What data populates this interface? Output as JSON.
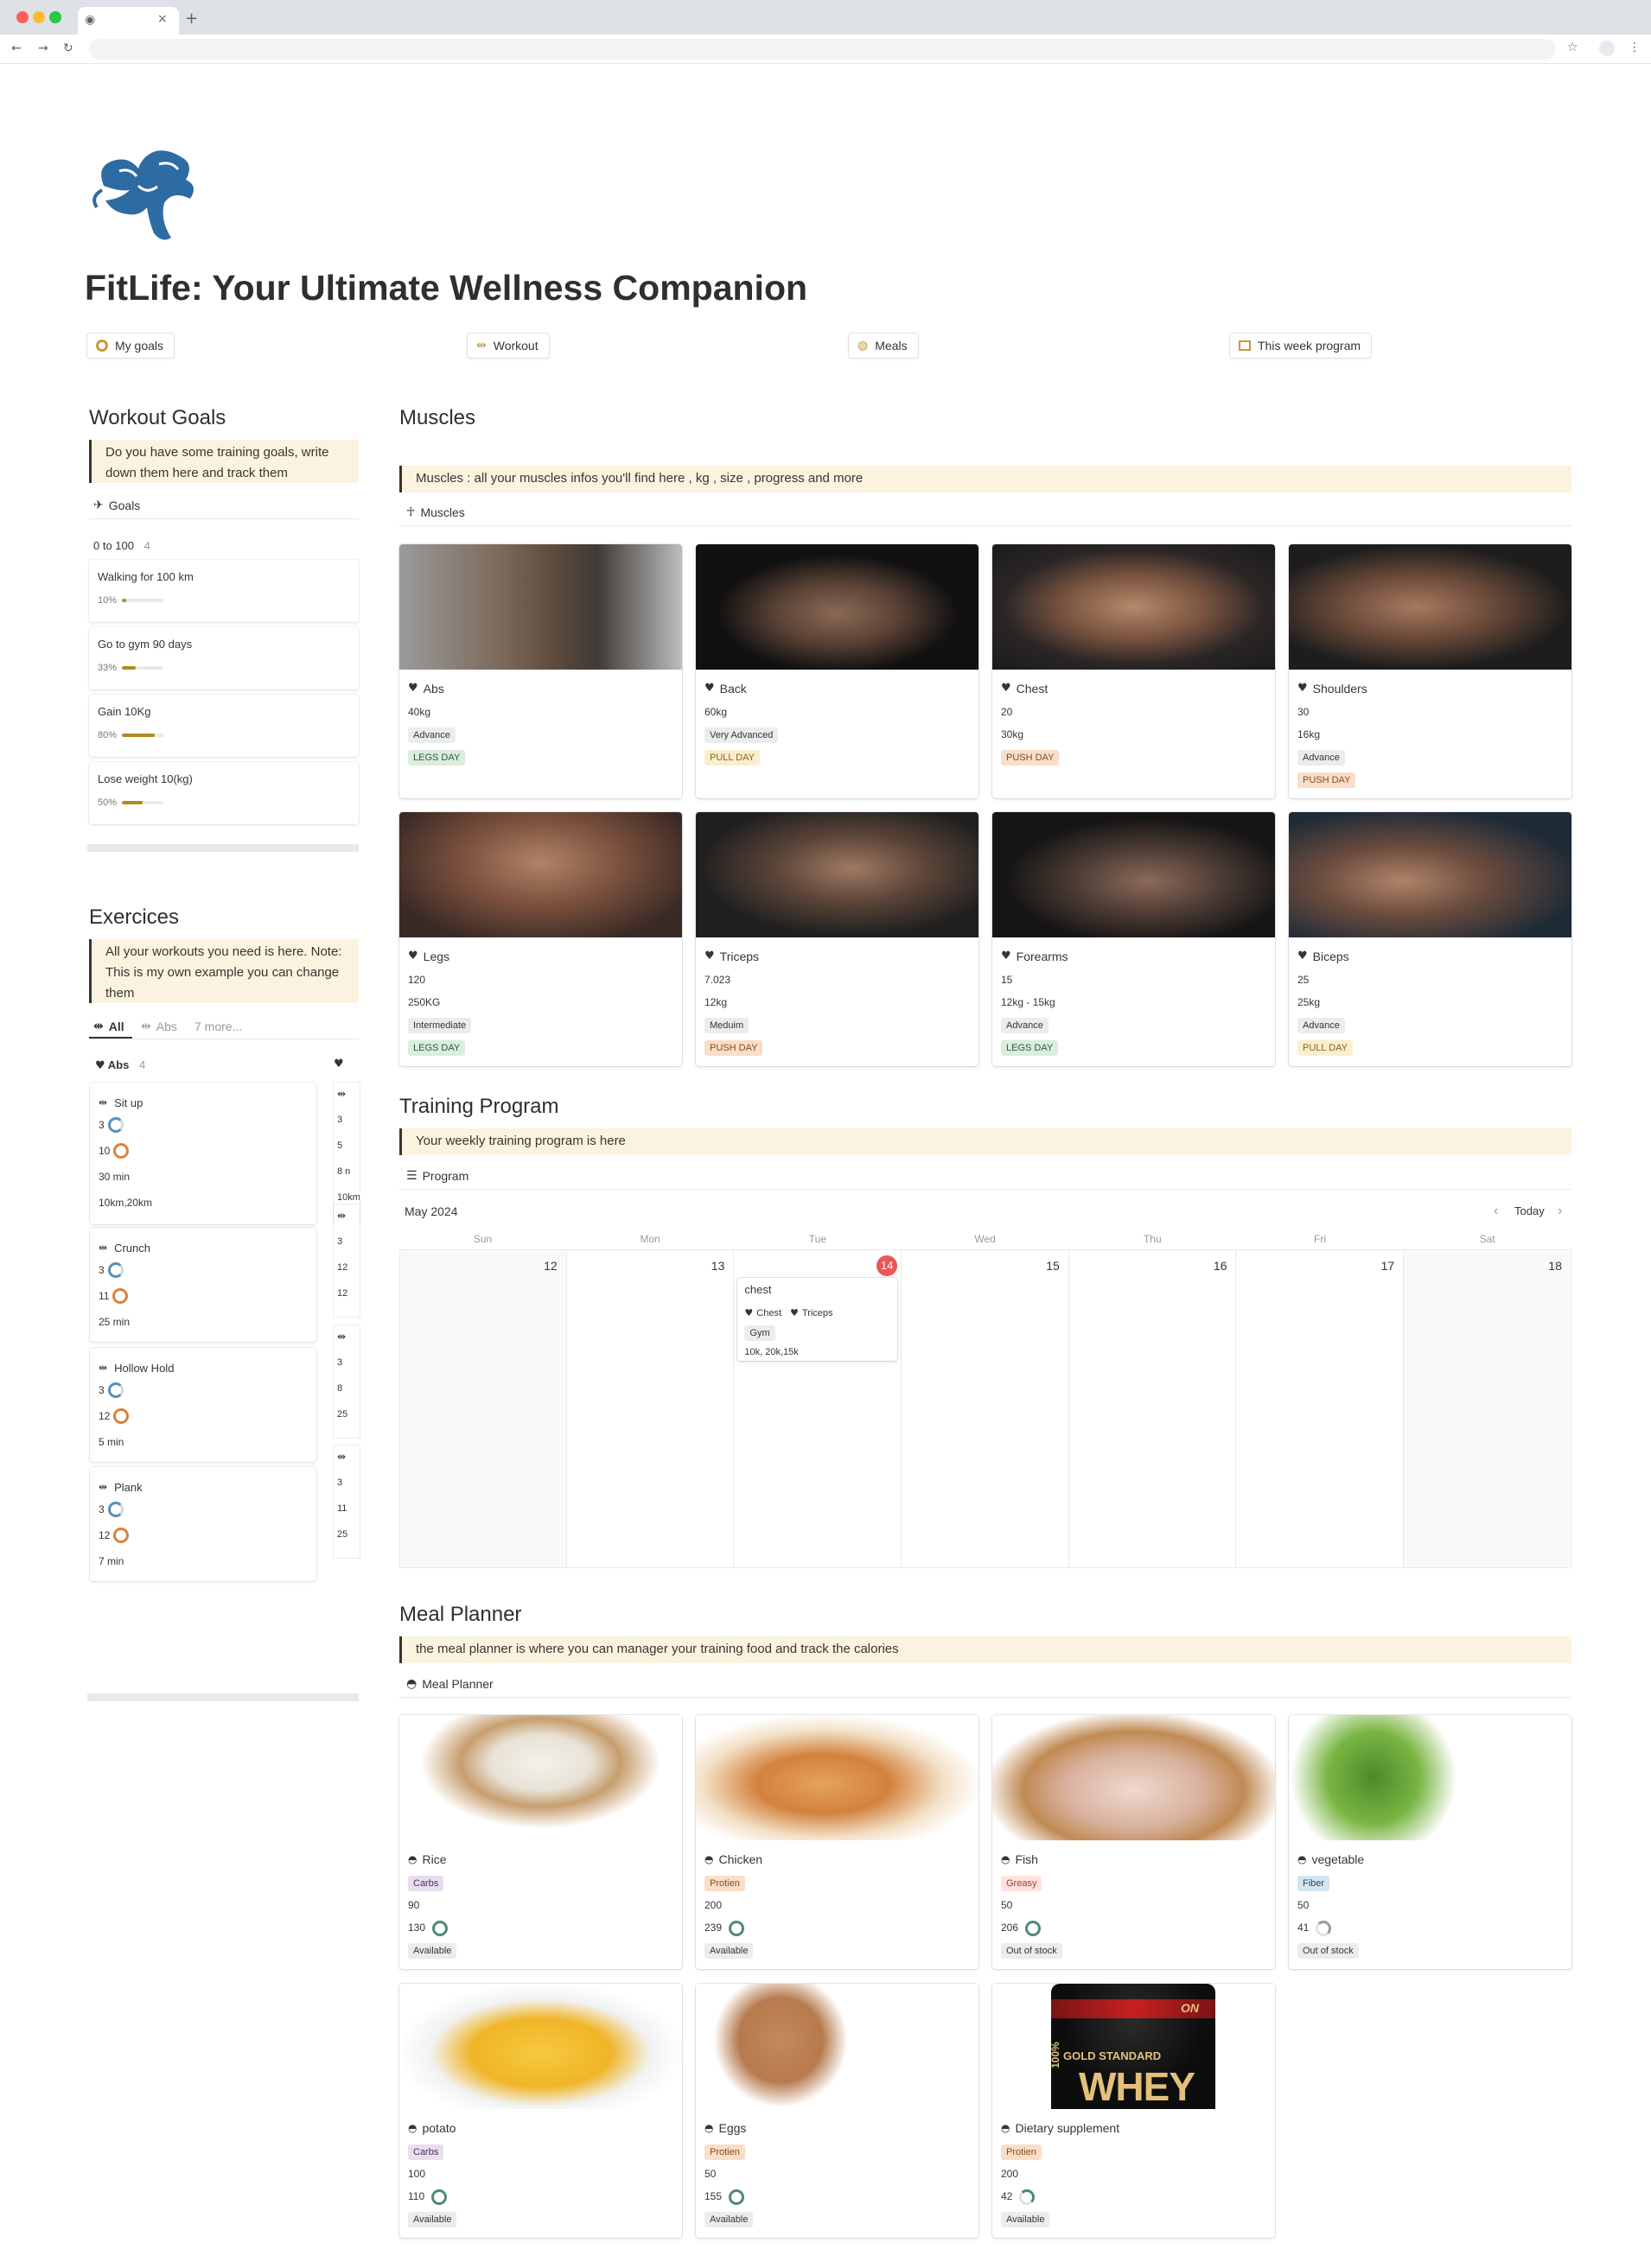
{
  "browser": {
    "tab_icon": "globe-icon",
    "tab_close": "×",
    "new_tab": "+"
  },
  "page": {
    "title": "FitLife: Your Ultimate Wellness Companion",
    "nav": [
      "My goals",
      "Workout",
      "Meals",
      "This week program"
    ]
  },
  "goals_section": {
    "heading": "Workout Goals",
    "callout": "Do  you have some training goals, write down them here and track them",
    "view_label": "Goals",
    "group_label": "0 to 100",
    "group_count": "4",
    "items": [
      {
        "name": "Walking for 100 km",
        "pct_label": "10%",
        "progress": 10
      },
      {
        "name": "Go to gym 90 days",
        "pct_label": "33%",
        "progress": 33
      },
      {
        "name": "Gain 10Kg",
        "pct_label": "80%",
        "progress": 80
      },
      {
        "name": "Lose weight 10(kg)",
        "pct_label": "50%",
        "progress": 50
      }
    ]
  },
  "exercises_section": {
    "heading": "Exercices",
    "callout": "All  your workouts you need is here. Note: This is my own example you can change them",
    "tabs": [
      "All",
      "Abs",
      "7 more..."
    ],
    "group_label": "Abs",
    "group_count": "4",
    "items": [
      {
        "name": "Sit up",
        "v1": "3",
        "v2": "10",
        "v3": "30 min",
        "v4": "10km,20km"
      },
      {
        "name": "Crunch",
        "v1": "3",
        "v2": "11",
        "v3": "25  min"
      },
      {
        "name": "Hollow Hold",
        "v1": "3",
        "v2": "12",
        "v3": "5  min"
      },
      {
        "name": "Plank",
        "v1": "3",
        "v2": "12",
        "v3": "7  min"
      }
    ],
    "second_column_peek": [
      [
        "3",
        "5",
        "8 n",
        "10km"
      ],
      [
        "3",
        "12",
        "12"
      ],
      [
        "3",
        "8",
        "25"
      ],
      [
        "3",
        "11",
        "25"
      ]
    ]
  },
  "muscles_section": {
    "heading": "Muscles",
    "callout": "Muscles : all your muscles infos you'll find here , kg , size , progress and more",
    "view_label": "Muscles",
    "cards": [
      {
        "name": "Abs",
        "lines": [
          "40kg"
        ],
        "tags": [
          {
            "t": "Advance",
            "c": "gray"
          },
          {
            "t": "LEGS DAY",
            "c": "green"
          }
        ]
      },
      {
        "name": "Back",
        "lines": [
          "60kg"
        ],
        "tags": [
          {
            "t": "Very Advanced",
            "c": "gray"
          },
          {
            "t": "PULL DAY",
            "c": "yellow"
          }
        ]
      },
      {
        "name": "Chest",
        "lines": [
          "20",
          "30kg"
        ],
        "tags": [
          {
            "t": "PUSH DAY",
            "c": "orange"
          }
        ]
      },
      {
        "name": "Shoulders",
        "lines": [
          "30",
          "16kg"
        ],
        "tags": [
          {
            "t": "Advance",
            "c": "gray"
          },
          {
            "t": "PUSH DAY",
            "c": "orange"
          }
        ]
      },
      {
        "name": "Legs",
        "lines": [
          "120",
          "250KG"
        ],
        "tags": [
          {
            "t": "Intermediate",
            "c": "gray"
          },
          {
            "t": "LEGS DAY",
            "c": "green"
          }
        ]
      },
      {
        "name": "Triceps",
        "lines": [
          "7.023",
          "12kg"
        ],
        "tags": [
          {
            "t": "Meduim",
            "c": "gray"
          },
          {
            "t": "PUSH DAY",
            "c": "orange"
          }
        ]
      },
      {
        "name": "Forearms",
        "lines": [
          "15",
          "12kg - 15kg"
        ],
        "tags": [
          {
            "t": "Advance",
            "c": "gray"
          },
          {
            "t": "LEGS DAY",
            "c": "green"
          }
        ]
      },
      {
        "name": "Biceps",
        "lines": [
          "25",
          "25kg"
        ],
        "tags": [
          {
            "t": "Advance",
            "c": "gray"
          },
          {
            "t": "PULL DAY",
            "c": "yellow"
          }
        ]
      }
    ]
  },
  "training_section": {
    "heading": "Training Program",
    "callout": "Your weekly training program is here",
    "view_label": "Program",
    "month": "May 2024",
    "today_label": "Today",
    "prev": "‹",
    "next": "›",
    "weekdays": [
      "Sun",
      "Mon",
      "Tue",
      "Wed",
      "Thu",
      "Fri",
      "Sat"
    ],
    "days": [
      "12",
      "13",
      "14",
      "15",
      "16",
      "17",
      "18"
    ],
    "event": {
      "title": "chest",
      "muscles": [
        "Chest",
        "Triceps"
      ],
      "place": "Gym",
      "note": "10k, 20k,15k"
    }
  },
  "meal_section": {
    "heading": "Meal Planner",
    "callout": "the meal planner is where you can manager  your training food and track the calories",
    "view_label": "Meal Planner",
    "cards": [
      {
        "name": "Rice",
        "type": "Carbs",
        "type_c": "purple",
        "a": "90",
        "b": "130",
        "status": "Available"
      },
      {
        "name": "Chicken",
        "type": "Protien",
        "type_c": "orange",
        "a": "200",
        "b": "239",
        "status": "Available"
      },
      {
        "name": "Fish",
        "type": "Greasy",
        "type_c": "red",
        "a": "50",
        "b": "206",
        "status": "Out of stock"
      },
      {
        "name": "vegetable",
        "type": "Fiber",
        "type_c": "blue",
        "a": "50",
        "b": "41",
        "status": "Out of stock"
      },
      {
        "name": "potato",
        "type": "Carbs",
        "type_c": "purple",
        "a": "100",
        "b": "110",
        "status": "Available"
      },
      {
        "name": "Eggs",
        "type": "Protien",
        "type_c": "orange",
        "a": "50",
        "b": "155",
        "status": "Available"
      },
      {
        "name": "Dietary supplement",
        "type": "Protien",
        "type_c": "orange",
        "a": "200",
        "b": "42",
        "status": "Available"
      }
    ],
    "whey_label": "GOLD STANDARD",
    "whey_big": "WHEY",
    "whey_side": "100%",
    "whey_logo": "ON"
  },
  "colors": {
    "callout_bg": "#fbf3e0",
    "today_red": "#eb5757",
    "progress": "#b08a1f",
    "ring_blue": "#5a8fb5",
    "ring_orange": "#d9823a",
    "ring_green": "#4e8a72"
  }
}
